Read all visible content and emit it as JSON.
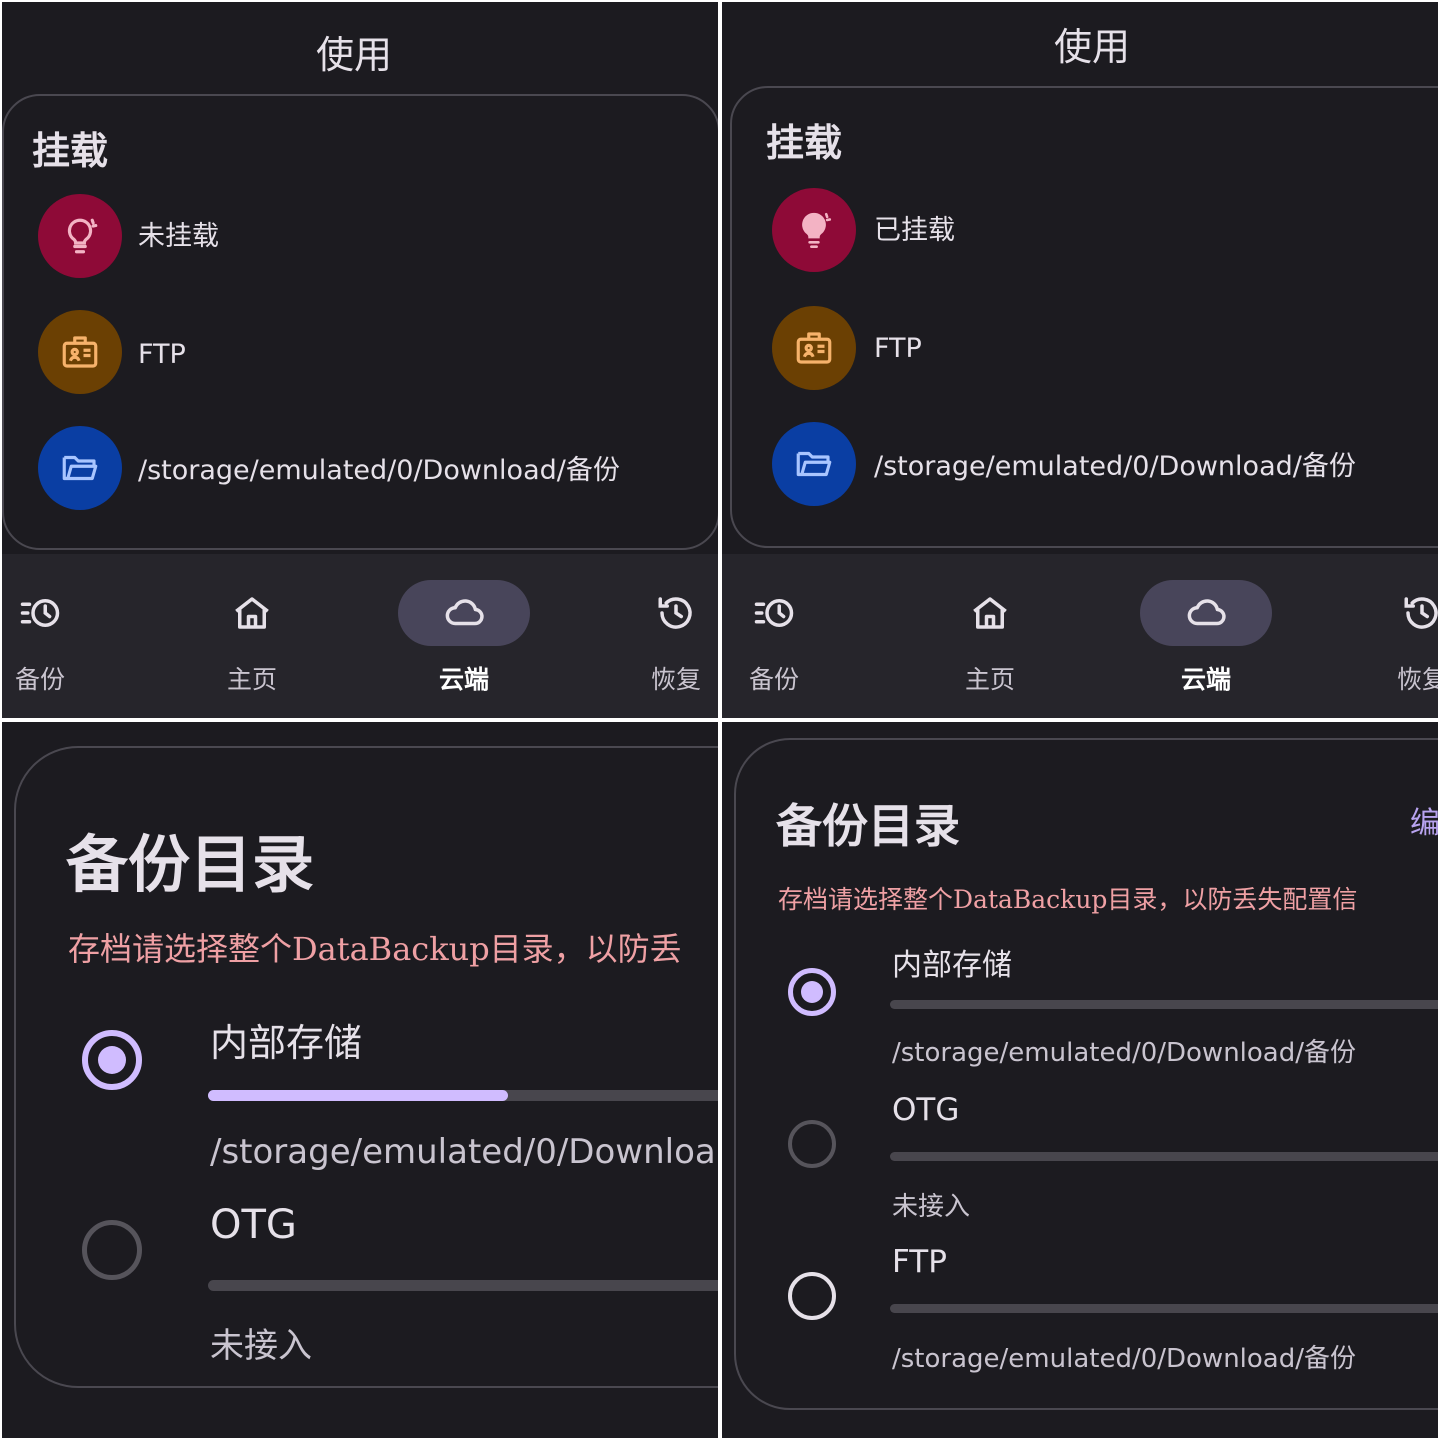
{
  "panel1": {
    "screen_title": "使用",
    "card_title": "挂载",
    "rows": [
      {
        "icon": "lightbulb-outline-icon",
        "text": "未挂载",
        "color": "#8e0a37"
      },
      {
        "icon": "ftp-badge-icon",
        "text": "FTP",
        "color": "#6b4003"
      },
      {
        "icon": "folder-open-icon",
        "text": "/storage/emulated/0/Download/备份",
        "color": "#0a3ea3"
      }
    ],
    "nav": [
      {
        "label": "备份",
        "icon": "backup-history-icon",
        "active": false
      },
      {
        "label": "主页",
        "icon": "home-icon",
        "active": false
      },
      {
        "label": "云端",
        "icon": "cloud-icon",
        "active": true
      },
      {
        "label": "恢复",
        "icon": "restore-icon",
        "active": false
      }
    ]
  },
  "panel2": {
    "screen_title": "使用",
    "card_title": "挂载",
    "rows": [
      {
        "icon": "lightbulb-filled-icon",
        "text": "已挂载",
        "color": "#8e0a37"
      },
      {
        "icon": "ftp-badge-icon",
        "text": "FTP",
        "color": "#6b4003"
      },
      {
        "icon": "folder-open-icon",
        "text": "/storage/emulated/0/Download/备份",
        "color": "#0a3ea3"
      }
    ],
    "nav": [
      {
        "label": "备份",
        "icon": "backup-history-icon",
        "active": false
      },
      {
        "label": "主页",
        "icon": "home-icon",
        "active": false
      },
      {
        "label": "云端",
        "icon": "cloud-icon",
        "active": true
      },
      {
        "label": "恢复",
        "icon": "restore-icon",
        "active": false
      }
    ]
  },
  "panel3": {
    "title": "备份目录",
    "warning": "存档请选择整个DataBackup目录，以防丢",
    "options": [
      {
        "label": "内部存储",
        "selected": true,
        "usage_fraction": 0.5,
        "sub": "/storage/emulated/0/Downloa"
      },
      {
        "label": "OTG",
        "selected": false,
        "usage_fraction": 0,
        "sub": "未接入"
      }
    ]
  },
  "panel4": {
    "title": "备份目录",
    "edit_label": "编",
    "warning": "存档请选择整个DataBackup目录，以防丢失配置信",
    "options": [
      {
        "label": "内部存储",
        "selected": true,
        "usage_fraction": 0,
        "sub": "/storage/emulated/0/Download/备份"
      },
      {
        "label": "OTG",
        "selected": false,
        "usage_fraction": 0,
        "sub": "未接入"
      },
      {
        "label": "FTP",
        "selected": false,
        "usage_fraction": 0,
        "sub": "/storage/emulated/0/Download/备份"
      }
    ]
  },
  "colors": {
    "background": "#1c1b20",
    "navbar": "#26252b",
    "accent": "#d0bcff",
    "warning_text": "#efa0a4",
    "card_border": "#4a4850"
  }
}
